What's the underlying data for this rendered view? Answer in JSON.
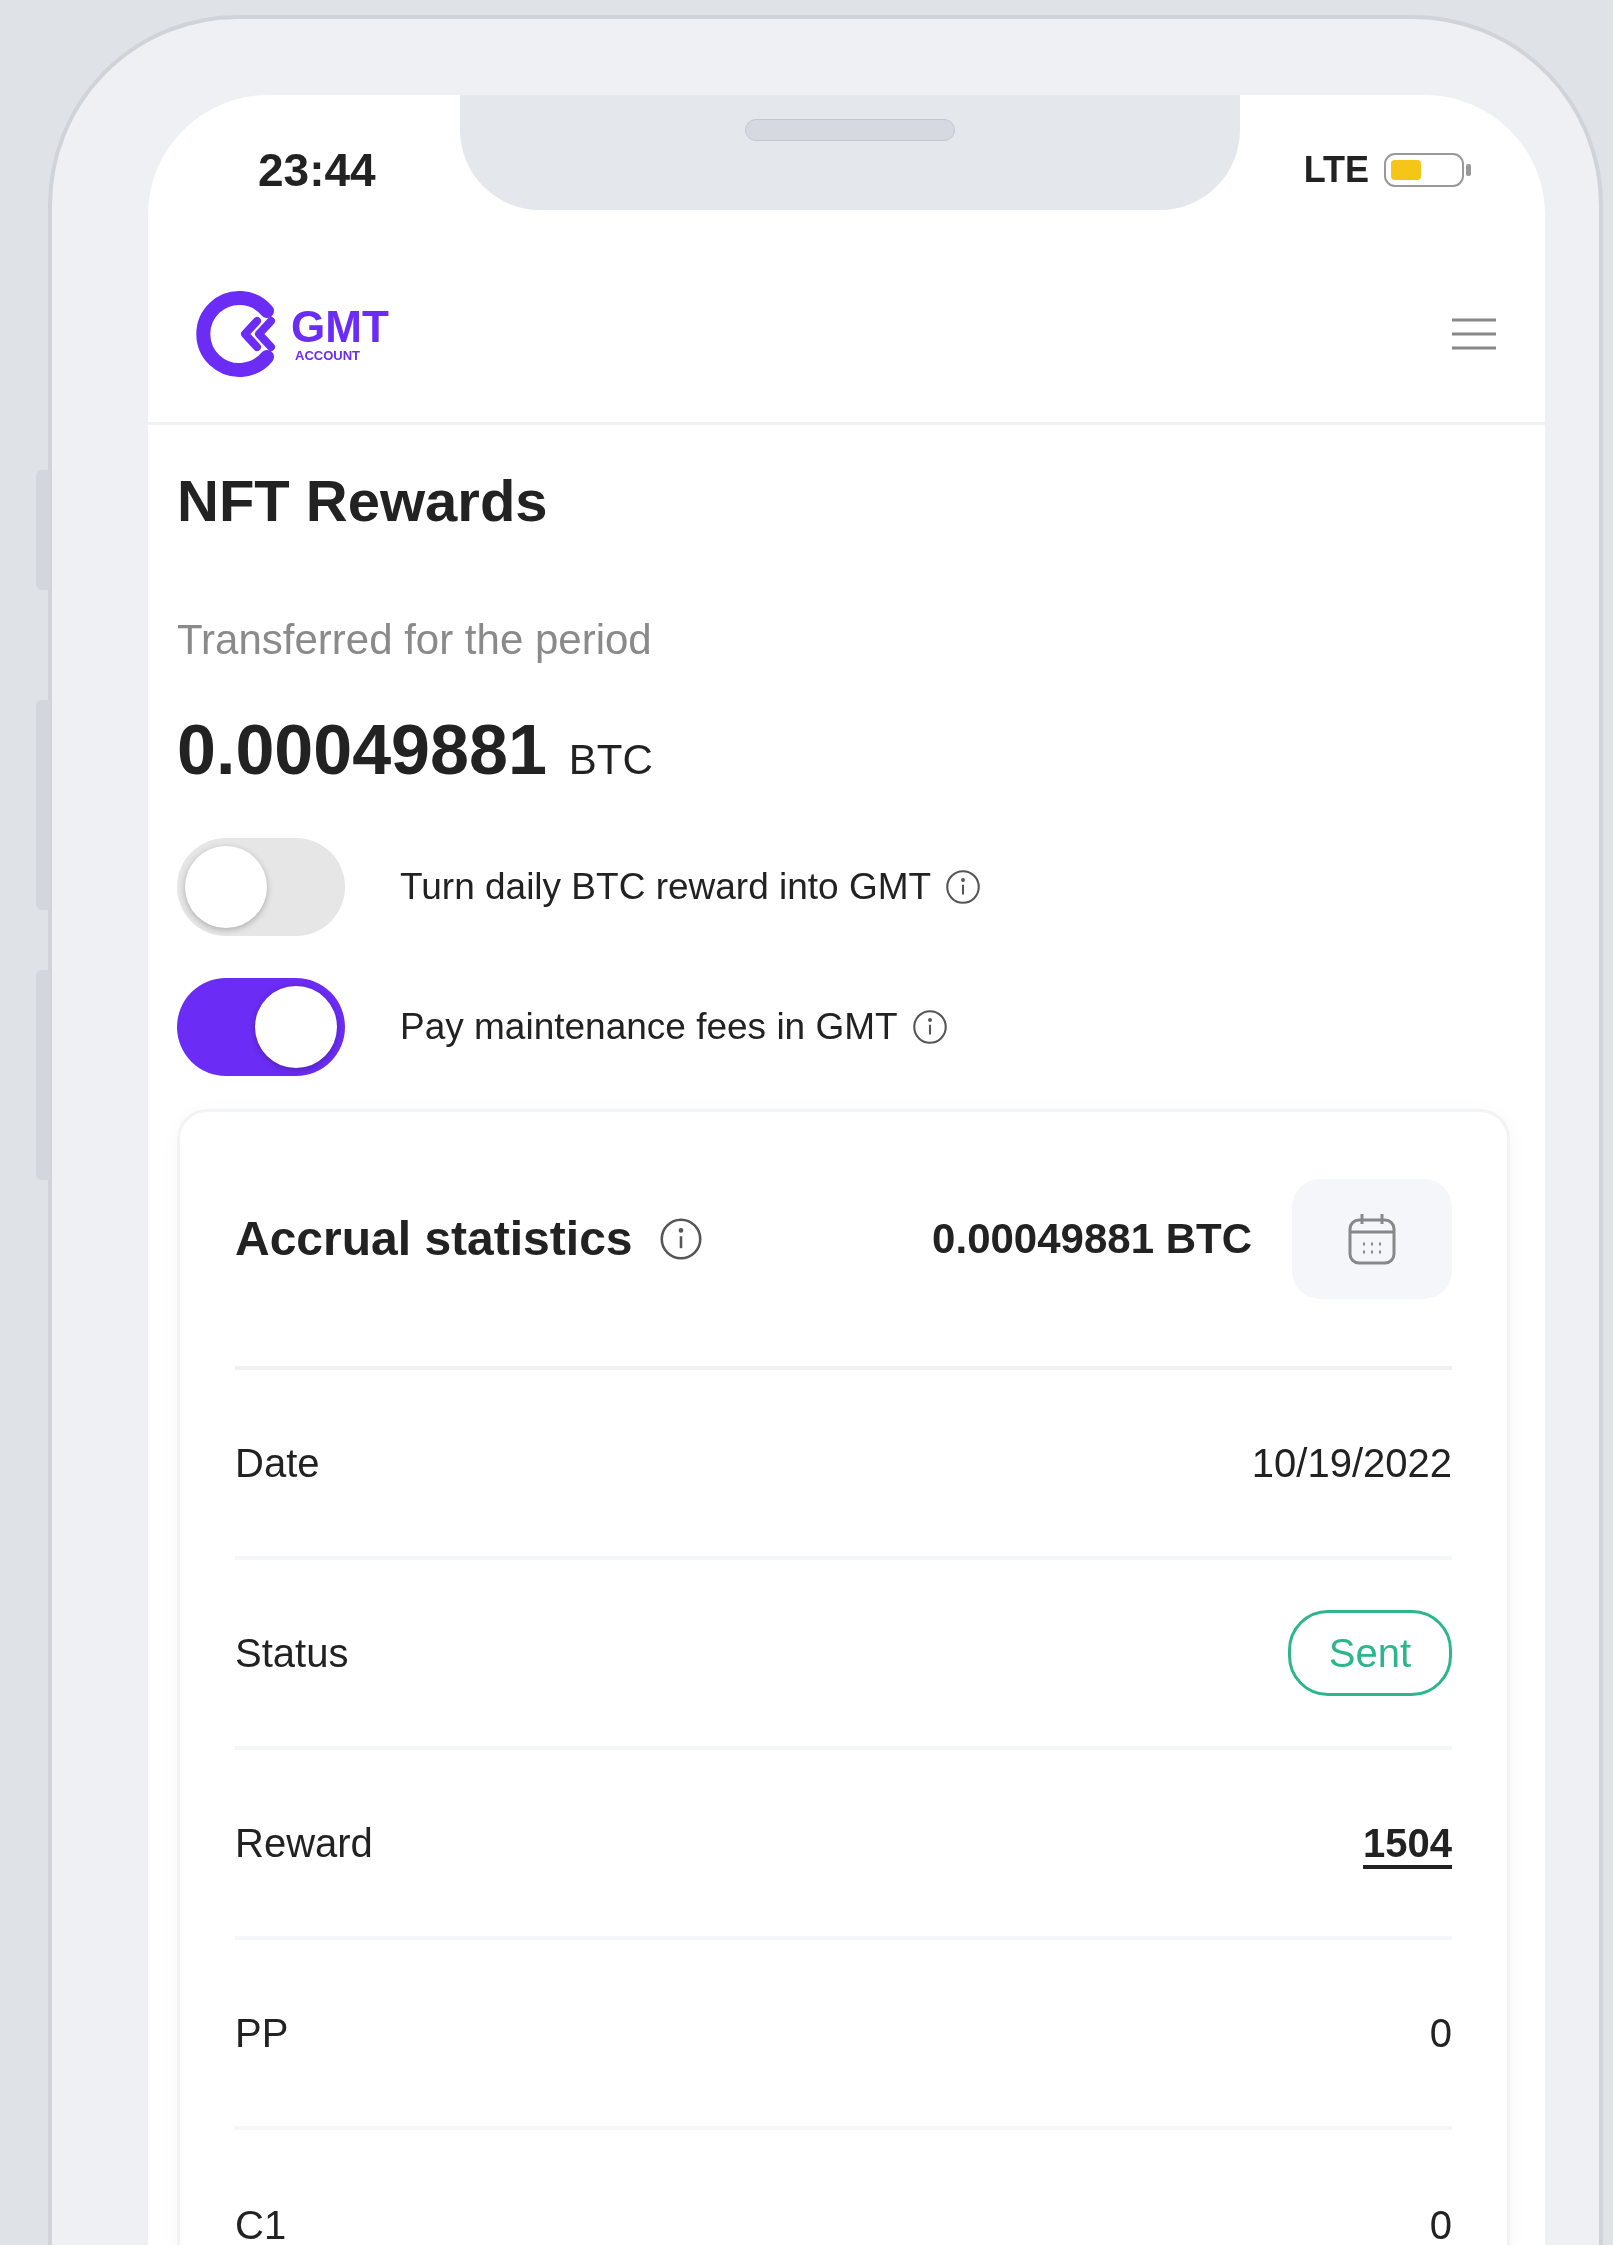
{
  "status_bar": {
    "time": "23:44",
    "network": "LTE"
  },
  "header": {
    "logo": {
      "wordmark": "GMT",
      "subtitle": "ACCOUNT"
    }
  },
  "page_title": "NFT Rewards",
  "period": {
    "label": "Transferred for the period",
    "amount": "0.00049881",
    "currency": "BTC"
  },
  "toggles": [
    {
      "label": "Turn daily BTC reward into GMT",
      "on": false
    },
    {
      "label": "Pay maintenance fees in GMT",
      "on": true
    }
  ],
  "statistics": {
    "title": "Accrual statistics",
    "total": "0.00049881 BTC",
    "rows": [
      {
        "label": "Date",
        "value": "10/19/2022",
        "kind": "text"
      },
      {
        "label": "Status",
        "value": "Sent",
        "kind": "badge"
      },
      {
        "label": "Reward",
        "value": "1504",
        "kind": "link"
      },
      {
        "label": "PP",
        "value": "0",
        "kind": "text"
      },
      {
        "label": "C1",
        "value": "0",
        "kind": "text"
      }
    ]
  }
}
